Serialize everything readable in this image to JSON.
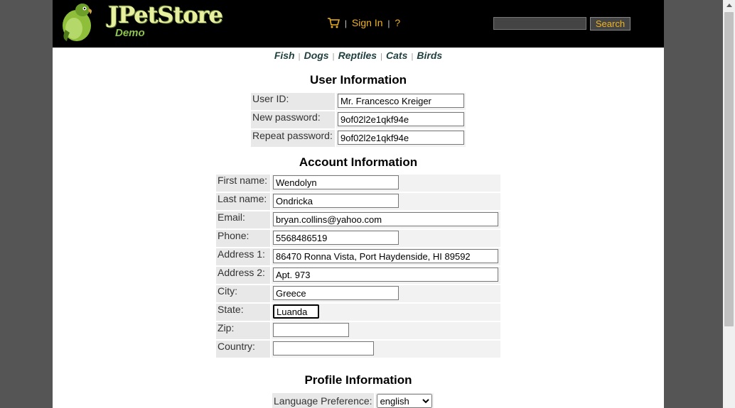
{
  "header": {
    "logo_title": "JPetStore",
    "logo_subtitle": "Demo",
    "sign_in": "Sign In",
    "help": "?",
    "search_placeholder": "",
    "search_button": "Search"
  },
  "quicklinks": [
    "Fish",
    "Dogs",
    "Reptiles",
    "Cats",
    "Birds"
  ],
  "user_info": {
    "heading": "User Information",
    "fields": [
      {
        "label": "User ID:",
        "value": "Mr. Francesco Kreiger"
      },
      {
        "label": "New password:",
        "value": "9of02l2e1qkf94e"
      },
      {
        "label": "Repeat password:",
        "value": "9of02l2e1qkf94e"
      }
    ]
  },
  "account_info": {
    "heading": "Account Information",
    "fields": [
      {
        "label": "First name:",
        "value": "Wendolyn"
      },
      {
        "label": "Last name:",
        "value": "Ondricka"
      },
      {
        "label": "Email:",
        "value": "bryan.collins@yahoo.com"
      },
      {
        "label": "Phone:",
        "value": "5568486519"
      },
      {
        "label": "Address 1:",
        "value": "86470 Ronna Vista, Port Haydenside, HI 89592"
      },
      {
        "label": "Address 2:",
        "value": "Apt. 973"
      },
      {
        "label": "City:",
        "value": "Greece"
      },
      {
        "label": "State:",
        "value": "Luanda"
      },
      {
        "label": "Zip:",
        "value": ""
      },
      {
        "label": "Country:",
        "value": ""
      }
    ]
  },
  "profile_info": {
    "heading": "Profile Information",
    "language_label": "Language Preference:",
    "language_value": "english"
  },
  "colors": {
    "header_bg": "#000000",
    "link_accent": "#f0b41e",
    "outer_bg": "#555555"
  }
}
